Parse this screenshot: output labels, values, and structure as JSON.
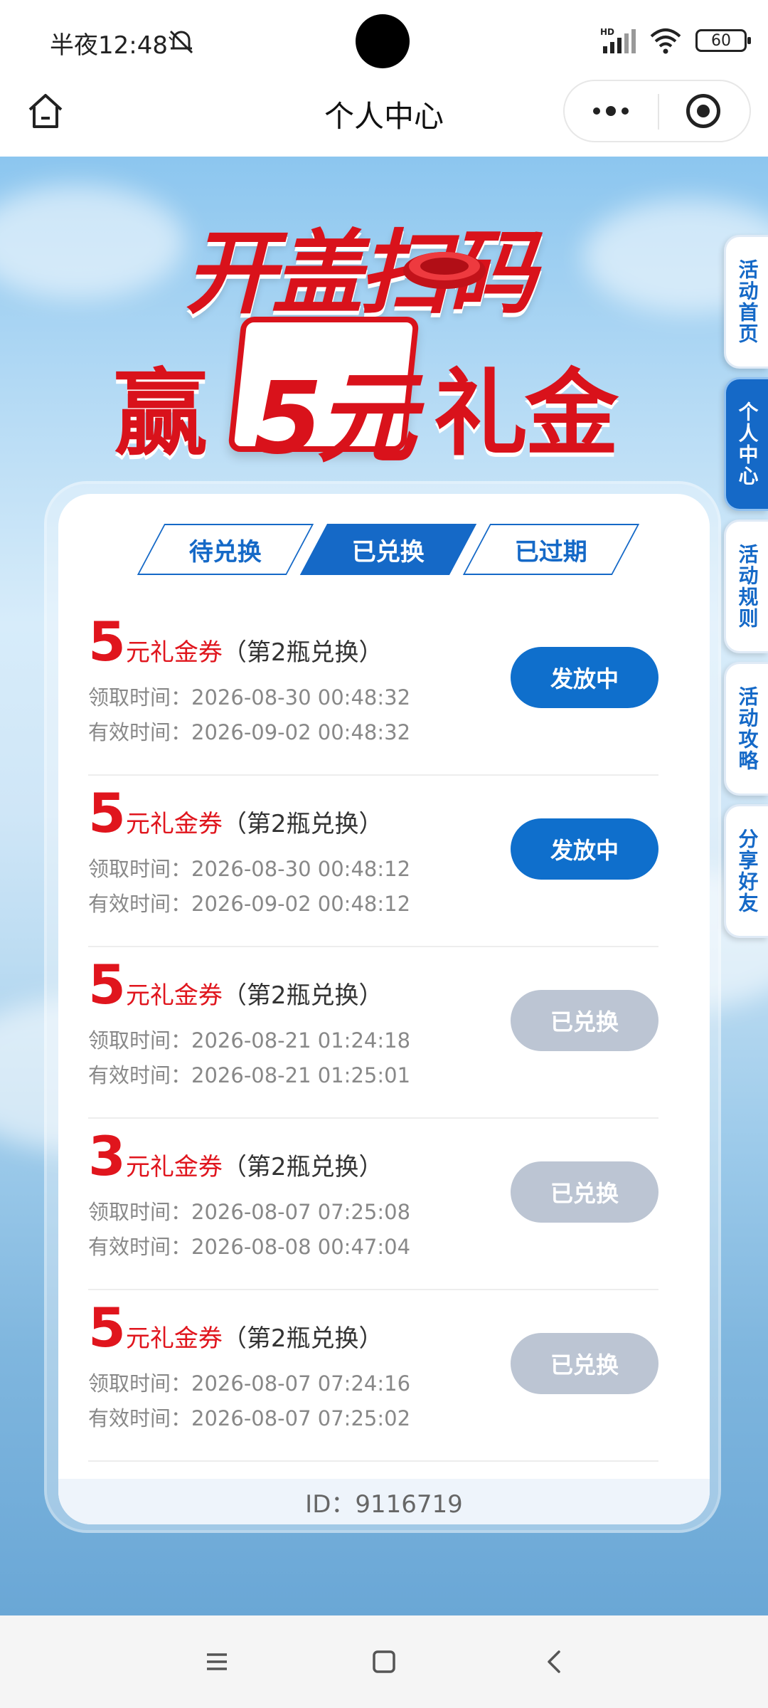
{
  "status_bar": {
    "time": "半夜12:48",
    "network": "HD",
    "battery": "60"
  },
  "header": {
    "title": "个人中心"
  },
  "banner": {
    "line1": "开盖扫码",
    "win": "赢",
    "amount": "5元",
    "gift": "礼金"
  },
  "side_nav": [
    {
      "label": "活动首页",
      "active": false
    },
    {
      "label": "个人中心",
      "active": true
    },
    {
      "label": "活动规则",
      "active": false
    },
    {
      "label": "活动攻略",
      "active": false
    },
    {
      "label": "分享好友",
      "active": false
    }
  ],
  "tabs": [
    {
      "label": "待兑换",
      "active": false
    },
    {
      "label": "已兑换",
      "active": true
    },
    {
      "label": "已过期",
      "active": false
    }
  ],
  "vouchers": [
    {
      "amount": "5",
      "unit": "元礼金券",
      "note": "（第2瓶兑换）",
      "claim_label": "领取时间：",
      "claim_time": "2026-08-30 00:48:32",
      "valid_label": "有效时间：",
      "valid_time": "2026-09-02 00:48:32",
      "status": "发放中",
      "status_style": "blue"
    },
    {
      "amount": "5",
      "unit": "元礼金券",
      "note": "（第2瓶兑换）",
      "claim_label": "领取时间：",
      "claim_time": "2026-08-30 00:48:12",
      "valid_label": "有效时间：",
      "valid_time": "2026-09-02 00:48:12",
      "status": "发放中",
      "status_style": "blue"
    },
    {
      "amount": "5",
      "unit": "元礼金券",
      "note": "（第2瓶兑换）",
      "claim_label": "领取时间：",
      "claim_time": "2026-08-21 01:24:18",
      "valid_label": "有效时间：",
      "valid_time": "2026-08-21 01:25:01",
      "status": "已兑换",
      "status_style": "gray"
    },
    {
      "amount": "3",
      "unit": "元礼金券",
      "note": "（第2瓶兑换）",
      "claim_label": "领取时间：",
      "claim_time": "2026-08-07 07:25:08",
      "valid_label": "有效时间：",
      "valid_time": "2026-08-08 00:47:04",
      "status": "已兑换",
      "status_style": "gray"
    },
    {
      "amount": "5",
      "unit": "元礼金券",
      "note": "（第2瓶兑换）",
      "claim_label": "领取时间：",
      "claim_time": "2026-08-07 07:24:16",
      "valid_label": "有效时间：",
      "valid_time": "2026-08-07 07:25:02",
      "status": "已兑换",
      "status_style": "gray"
    }
  ],
  "footer": {
    "id_text": "ID：9116719"
  },
  "colors": {
    "primary_blue": "#0f6fcc",
    "brand_red": "#d9121b",
    "disabled_gray": "#bcc5d3"
  }
}
